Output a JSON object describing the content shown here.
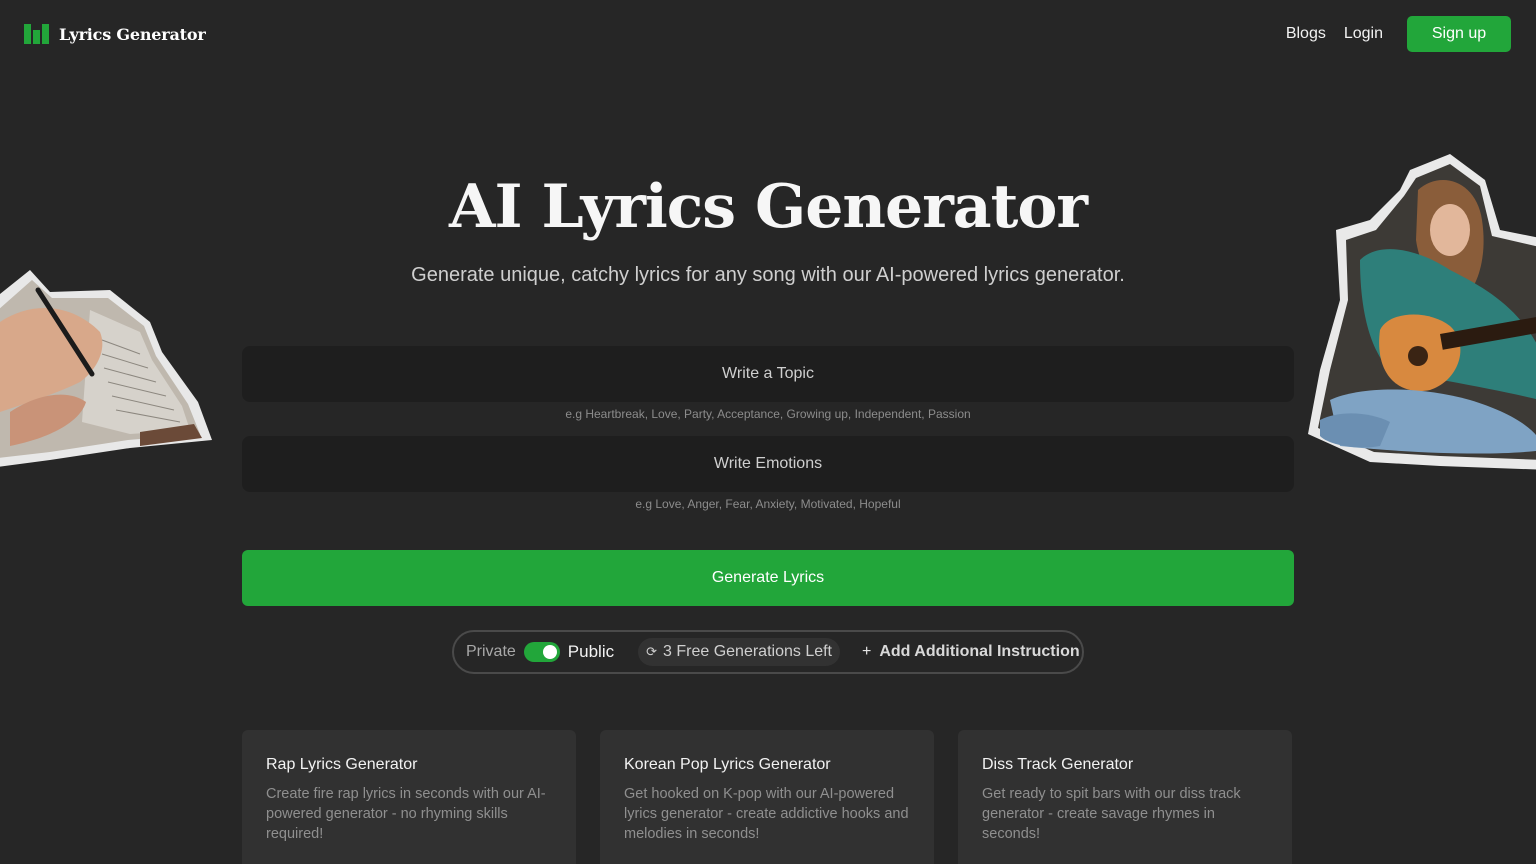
{
  "brand": {
    "name": "Lyrics Generator"
  },
  "nav": {
    "blogs": "Blogs",
    "login": "Login",
    "signup": "Sign up"
  },
  "hero": {
    "title": "AI Lyrics Generator",
    "subtitle": "Generate unique, catchy lyrics for any song with our AI-powered lyrics generator."
  },
  "form": {
    "topic": {
      "placeholder": "Write a Topic",
      "value": "",
      "hint": "e.g Heartbreak, Love, Party, Acceptance, Growing up, Independent, Passion"
    },
    "emotions": {
      "placeholder": "Write Emotions",
      "value": "",
      "hint": "e.g Love, Anger, Fear, Anxiety, Motivated, Hopeful"
    },
    "generate_label": "Generate Lyrics"
  },
  "options": {
    "private_label": "Private",
    "public_label": "Public",
    "visibility": "Public",
    "generations_left": "3 Free Generations Left",
    "add_instruction": "Add Additional Instruction"
  },
  "cards": [
    {
      "title": "Rap Lyrics Generator",
      "desc": "Create fire rap lyrics in seconds with our AI-powered generator - no rhyming skills required!"
    },
    {
      "title": "Korean Pop Lyrics Generator",
      "desc": "Get hooked on K-pop with our AI-powered lyrics generator - create addictive hooks and melodies in seconds!"
    },
    {
      "title": "Diss Track Generator",
      "desc": "Get ready to spit bars with our diss track generator - create savage rhymes in seconds!"
    }
  ],
  "colors": {
    "accent": "#22a63a",
    "background": "#262626",
    "field": "#1e1e1e",
    "card": "#313131"
  },
  "icons": {
    "logo": "bars-logo-icon",
    "generations": "refresh-icon",
    "add": "plus-icon"
  }
}
